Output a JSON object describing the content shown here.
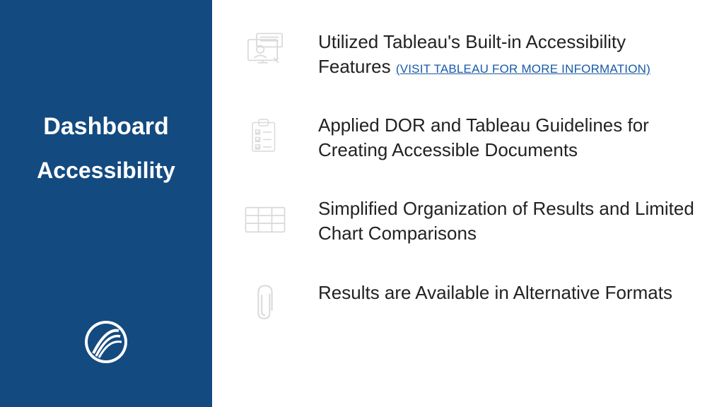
{
  "sidebar": {
    "title1": "Dashboard",
    "title2": "Accessibility"
  },
  "items": [
    {
      "text_prefix": "Utilized Tableau's Built-in Accessibility Features ",
      "link": "(VISIT TABLEAU FOR MORE INFORMATION)"
    },
    {
      "text": "Applied DOR and Tableau Guidelines for Creating Accessible Documents"
    },
    {
      "text": "Simplified Organization of Results and Limited Chart Comparisons"
    },
    {
      "text": "Results are Available in Alternative Formats"
    }
  ]
}
